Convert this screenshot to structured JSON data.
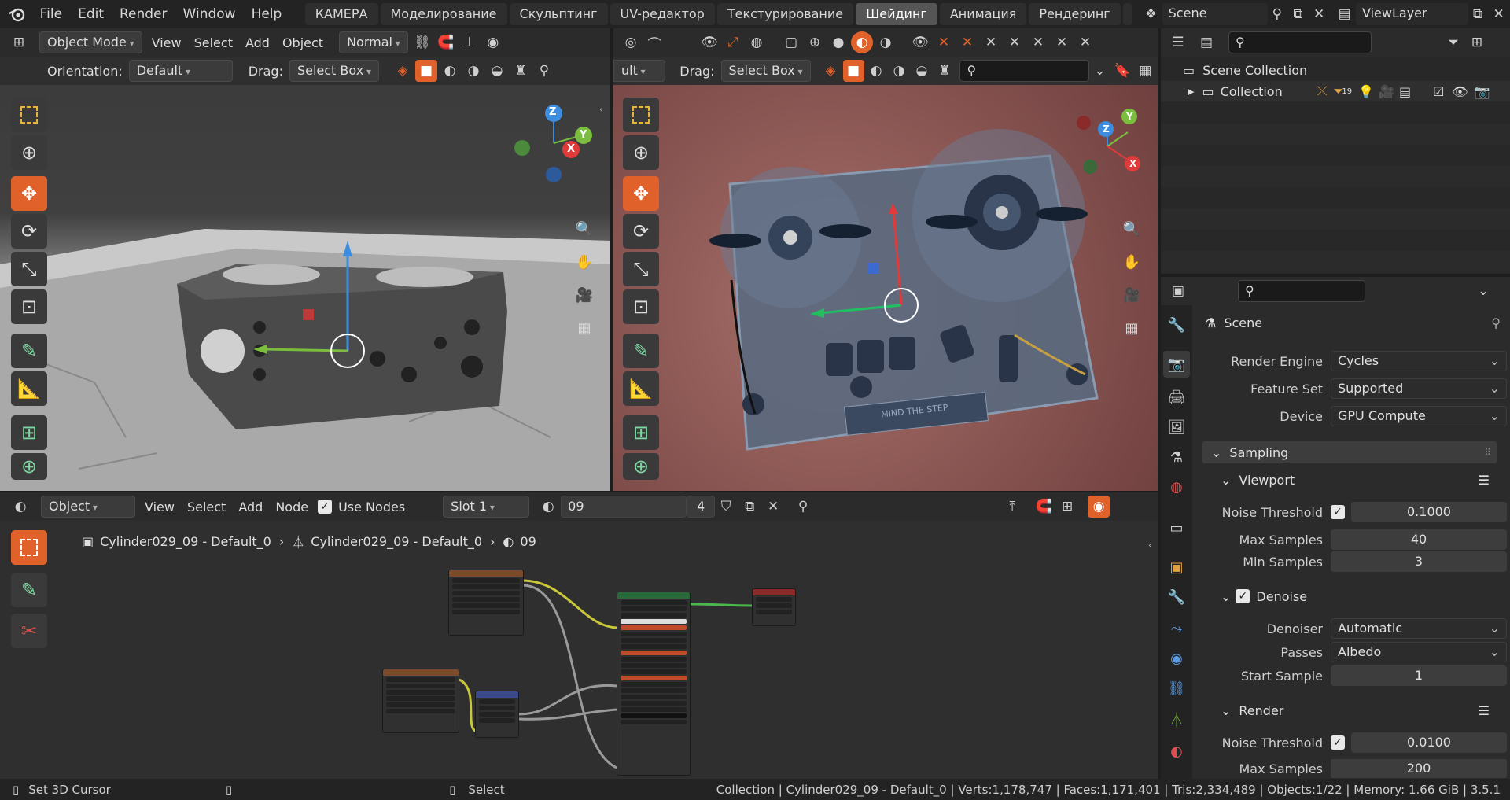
{
  "topbar": {
    "menus": [
      "File",
      "Edit",
      "Render",
      "Window",
      "Help"
    ],
    "workspaces": [
      {
        "label": "КАМЕРА",
        "active": false
      },
      {
        "label": "Моделирование",
        "active": false
      },
      {
        "label": "Скульптинг",
        "active": false
      },
      {
        "label": "UV-редактор",
        "active": false
      },
      {
        "label": "Текстурирование",
        "active": false
      },
      {
        "label": "Шейдинг",
        "active": true
      },
      {
        "label": "Анимация",
        "active": false
      },
      {
        "label": "Рендеринг",
        "active": false
      }
    ],
    "scene_name": "Scene",
    "view_layer": "ViewLayer"
  },
  "viewport_left": {
    "mode": "Object Mode",
    "menus": [
      "View",
      "Select",
      "Add",
      "Object"
    ],
    "orientation_global": "Normal",
    "orientation_label": "Orientation:",
    "orientation_value": "Default",
    "drag_label": "Drag:",
    "drag_value": "Select Box"
  },
  "viewport_right": {
    "orientation_partial": "ult",
    "drag_label": "Drag:",
    "drag_value": "Select Box",
    "plate_text": "MIND THE STEP"
  },
  "gizmo_labels": {
    "z": "Z",
    "y": "Y",
    "x": "X"
  },
  "node_editor": {
    "type": "Object",
    "menus": [
      "View",
      "Select",
      "Add",
      "Node"
    ],
    "use_nodes_label": "Use Nodes",
    "slot": "Slot 1",
    "material_name": "09",
    "material_users": "4",
    "breadcrumb": [
      "Cylinder029_09 - Default_0",
      "Cylinder029_09 - Default_0",
      "09"
    ]
  },
  "outliner": {
    "root": "Scene Collection",
    "collection": "Collection",
    "badge_count": "19"
  },
  "properties": {
    "title": "Scene",
    "render_engine_label": "Render Engine",
    "render_engine": "Cycles",
    "feature_set_label": "Feature Set",
    "feature_set": "Supported",
    "device_label": "Device",
    "device": "GPU Compute",
    "sampling_label": "Sampling",
    "viewport_label": "Viewport",
    "noise_threshold_label": "Noise Threshold",
    "viewport_noise_threshold": "0.1000",
    "max_samples_label": "Max Samples",
    "viewport_max_samples": "40",
    "min_samples_label": "Min Samples",
    "viewport_min_samples": "3",
    "denoise_label": "Denoise",
    "denoiser_label": "Denoiser",
    "denoiser": "Automatic",
    "passes_label": "Passes",
    "passes": "Albedo",
    "start_sample_label": "Start Sample",
    "start_sample": "1",
    "render_label": "Render",
    "render_noise_threshold": "0.0100",
    "render_max_samples": "200"
  },
  "statusbar": {
    "left_action": "Set 3D Cursor",
    "mid_action": "Select",
    "stats": "Collection | Cylinder029_09 - Default_0 | Verts:1,178,747 | Faces:1,171,401 | Tris:2,334,489 | Objects:1/22 | Memory: 1.66 GiB | 3.5.1"
  },
  "colors": {
    "accent": "#e0622a",
    "axis_x": "#e03a3a",
    "axis_y": "#7bbd3c",
    "axis_z": "#3c8de0"
  }
}
